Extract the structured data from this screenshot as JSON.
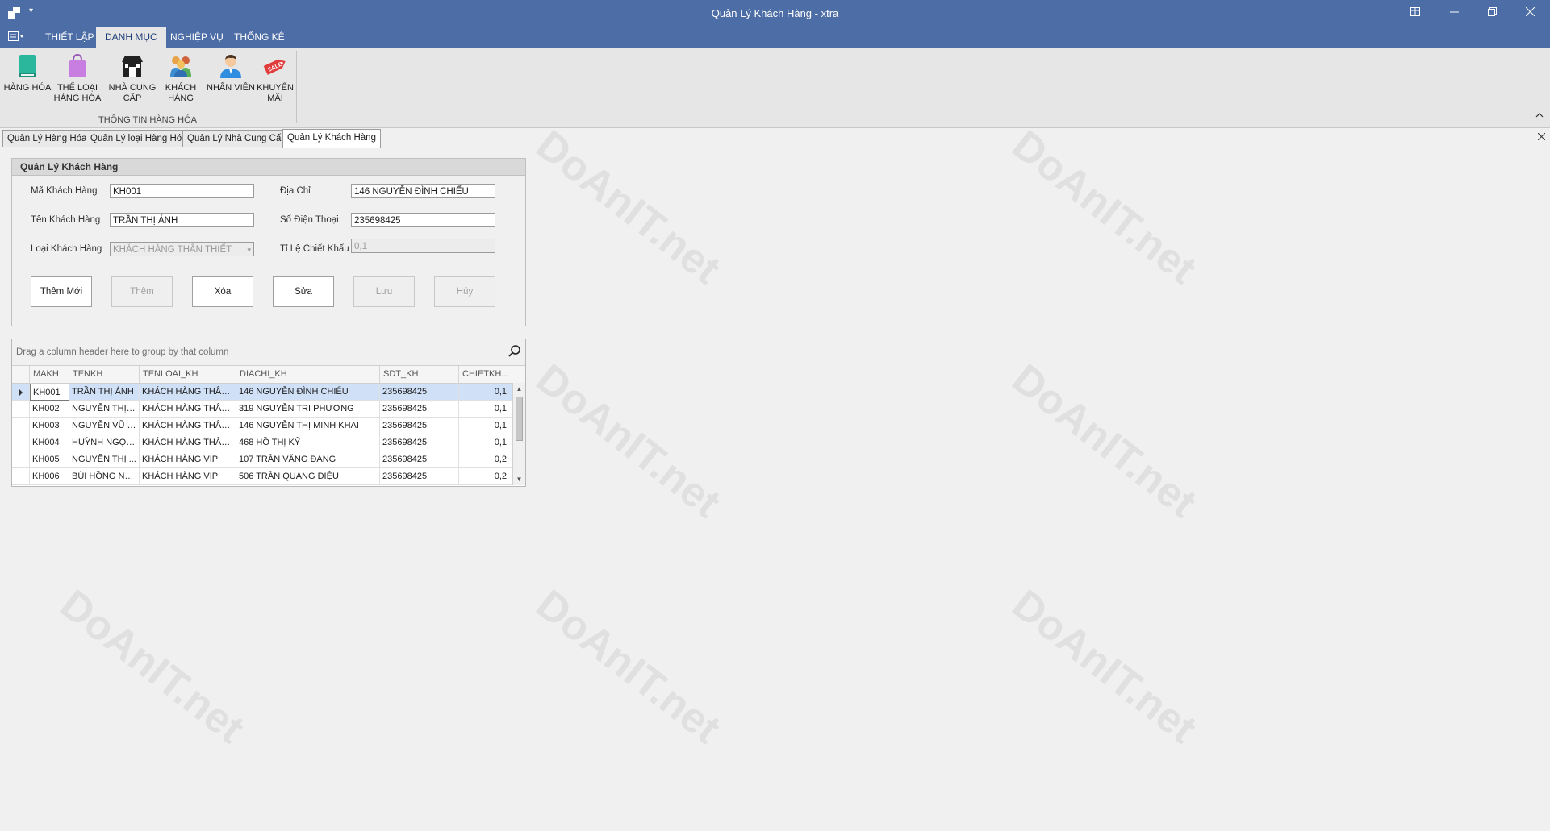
{
  "window": {
    "title": "Quản Lý Khách Hàng - xtra",
    "controls": [
      "restore-icon",
      "minimize-icon",
      "maximize-icon",
      "close-icon"
    ]
  },
  "ribbon": {
    "tabs": [
      {
        "label": "THIẾT LẬP"
      },
      {
        "label": "DANH MỤC",
        "active": true
      },
      {
        "label": "NGHIỆP VỤ"
      },
      {
        "label": "THỐNG KÊ"
      }
    ],
    "buttons": [
      {
        "label_line1": "HÀNG HÓA",
        "label_line2": "",
        "icon": "book-icon"
      },
      {
        "label_line1": "THỂ LOẠI",
        "label_line2": "HÀNG HÓA",
        "icon": "shopping-bag-icon"
      },
      {
        "label_line1": "NHÀ CUNG",
        "label_line2": "CẤP",
        "icon": "store-icon"
      },
      {
        "label_line1": "KHÁCH",
        "label_line2": "HÀNG",
        "icon": "customers-icon"
      },
      {
        "label_line1": "NHÂN VIÊN",
        "label_line2": "",
        "icon": "employee-icon"
      },
      {
        "label_line1": "KHUYẾN",
        "label_line2": "MÃI",
        "icon": "sale-tag-icon"
      }
    ],
    "group_label": "THÔNG TIN HÀNG HÓA"
  },
  "doc_tabs": [
    {
      "label": "Quản Lý Hàng Hóa"
    },
    {
      "label": "Quản Lý loại Hàng Hóa"
    },
    {
      "label": "Quản Lý Nhà Cung Cấp"
    },
    {
      "label": "Quản Lý Khách Hàng",
      "active": true
    }
  ],
  "form": {
    "title": "Quản Lý Khách Hàng",
    "labels": {
      "ma_kh": "Mã Khách Hàng",
      "ten_kh": "Tên Khách Hàng",
      "loai_kh": "Loại Khách Hàng",
      "dia_chi": "Địa Chỉ",
      "sdt": "Số Điện Thoại",
      "chiet_khau": "Tỉ Lệ Chiết Khấu"
    },
    "values": {
      "ma_kh": "KH001",
      "ten_kh": "TRẦN THỊ ÁNH",
      "loai_kh": "KHÁCH HÀNG THÂN THIẾT",
      "dia_chi": "146 NGUYỄN ĐÌNH CHIỂU",
      "sdt": "235698425",
      "chiet_khau": "0,1"
    },
    "buttons": {
      "them_moi": "Thêm Mới",
      "them": "Thêm",
      "xoa": "Xóa",
      "sua": "Sửa",
      "luu": "Lưu",
      "huy": "Hủy"
    }
  },
  "grid": {
    "group_hint": "Drag a column header here to group by that column",
    "columns": [
      "MAKH",
      "TENKH",
      "TENLOAI_KH",
      "DIACHI_KH",
      "SDT_KH",
      "CHIETKH..."
    ],
    "rows": [
      [
        "KH001",
        "TRẦN THỊ ÁNH",
        "KHÁCH HÀNG THÂN ...",
        "146 NGUYỄN ĐÌNH CHIỂU",
        "235698425",
        "0,1"
      ],
      [
        "KH002",
        "NGUYỄN THỊ MỘ...",
        "KHÁCH HÀNG THÂN ...",
        "319 NGUYỄN TRI PHƯƠNG",
        "235698425",
        "0,1"
      ],
      [
        "KH003",
        "NGUYỄN VŨ Á...",
        "KHÁCH HÀNG THÂN ...",
        "146 NGUYỄN THỊ MINH KHAI",
        "235698425",
        "0,1"
      ],
      [
        "KH004",
        "HUỲNH NGỌC...",
        "KHÁCH HÀNG THÂN ...",
        "468 HỒ THỊ KỶ",
        "235698425",
        "0,1"
      ],
      [
        "KH005",
        "NGUYỄN THỊ ...",
        "KHÁCH HÀNG VIP",
        "107 TRẦN VĂNG ĐANG",
        "235698425",
        "0,2"
      ],
      [
        "KH006",
        "BÙI HỒNG NG...",
        "KHÁCH HÀNG VIP",
        "506 TRẦN QUANG DIỆU",
        "235698425",
        "0,2"
      ]
    ],
    "selected_row": 0
  },
  "watermark": {
    "brand": "DoAnIT.net"
  },
  "colors": {
    "titlebar": "#4d6da6",
    "selected_row": "#cfe0f7"
  }
}
